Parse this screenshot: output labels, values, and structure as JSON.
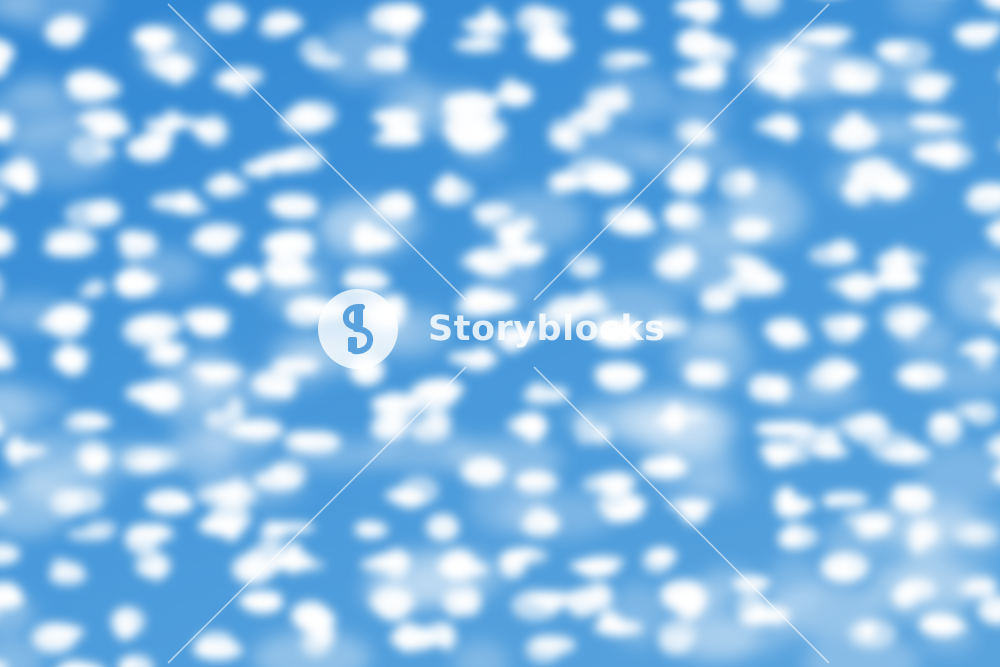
{
  "photo": {
    "subject": "altocumulus-clouds-blue-sky",
    "sky_color": "#3d8fd6",
    "cloud_color": "#ffffff"
  },
  "watermark": {
    "brand": "Storyblocks",
    "logo_icon": "storyblocks-logo-icon",
    "color": "#ffffff"
  }
}
